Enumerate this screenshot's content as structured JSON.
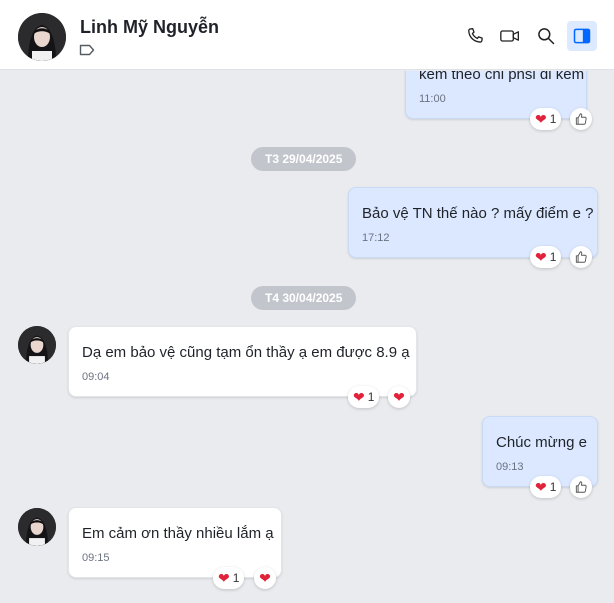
{
  "header": {
    "name": "Linh Mỹ Nguyễn",
    "icons": [
      "tag-icon",
      "phone-icon",
      "video-call-icon",
      "search-icon",
      "sidebar-toggle-icon"
    ]
  },
  "colors": {
    "outgoing_bubble": "#dbe8ff",
    "incoming_bubble": "#ffffff",
    "heart": "#e0233a",
    "date_pill": "#c2c6cc",
    "active_toggle": "#0068ff"
  },
  "messages": [
    {
      "direction": "out",
      "text": "kèm theo chi phsi đi kèm",
      "time": "11:00",
      "reaction_count": "1"
    },
    {
      "date_divider": "T3 29/04/2025"
    },
    {
      "direction": "out",
      "text": "Bảo vệ TN thế nào ? mấy điểm e ?",
      "time": "17:12",
      "reaction_count": "1"
    },
    {
      "date_divider": "T4 30/04/2025"
    },
    {
      "direction": "in",
      "text": "Dạ em bảo vệ cũng tạm ổn thầy ạ em được 8.9 ạ",
      "time": "09:04",
      "reaction_count": "1"
    },
    {
      "direction": "out",
      "text": "Chúc mừng e",
      "time": "09:13",
      "reaction_count": "1"
    },
    {
      "direction": "in",
      "text": "Em cảm ơn thầy nhiều lắm ạ",
      "time": "09:15",
      "reaction_count": "1"
    }
  ],
  "chat": {
    "m1": {
      "text": "kèm theo chi phsi đi kèm",
      "time": "11:00",
      "count": "1"
    },
    "d1": "T3 29/04/2025",
    "m2": {
      "text": "Bảo vệ TN thế nào ? mấy điểm e ?",
      "time": "17:12",
      "count": "1"
    },
    "d2": "T4 30/04/2025",
    "m3": {
      "text": "Dạ em bảo vệ cũng tạm ổn thầy ạ em được 8.9 ạ",
      "time": "09:04",
      "count": "1"
    },
    "m4": {
      "text": "Chúc mừng e",
      "time": "09:13",
      "count": "1"
    },
    "m5": {
      "text": "Em cảm ơn thầy nhiều lắm ạ",
      "time": "09:15",
      "count": "1"
    }
  }
}
